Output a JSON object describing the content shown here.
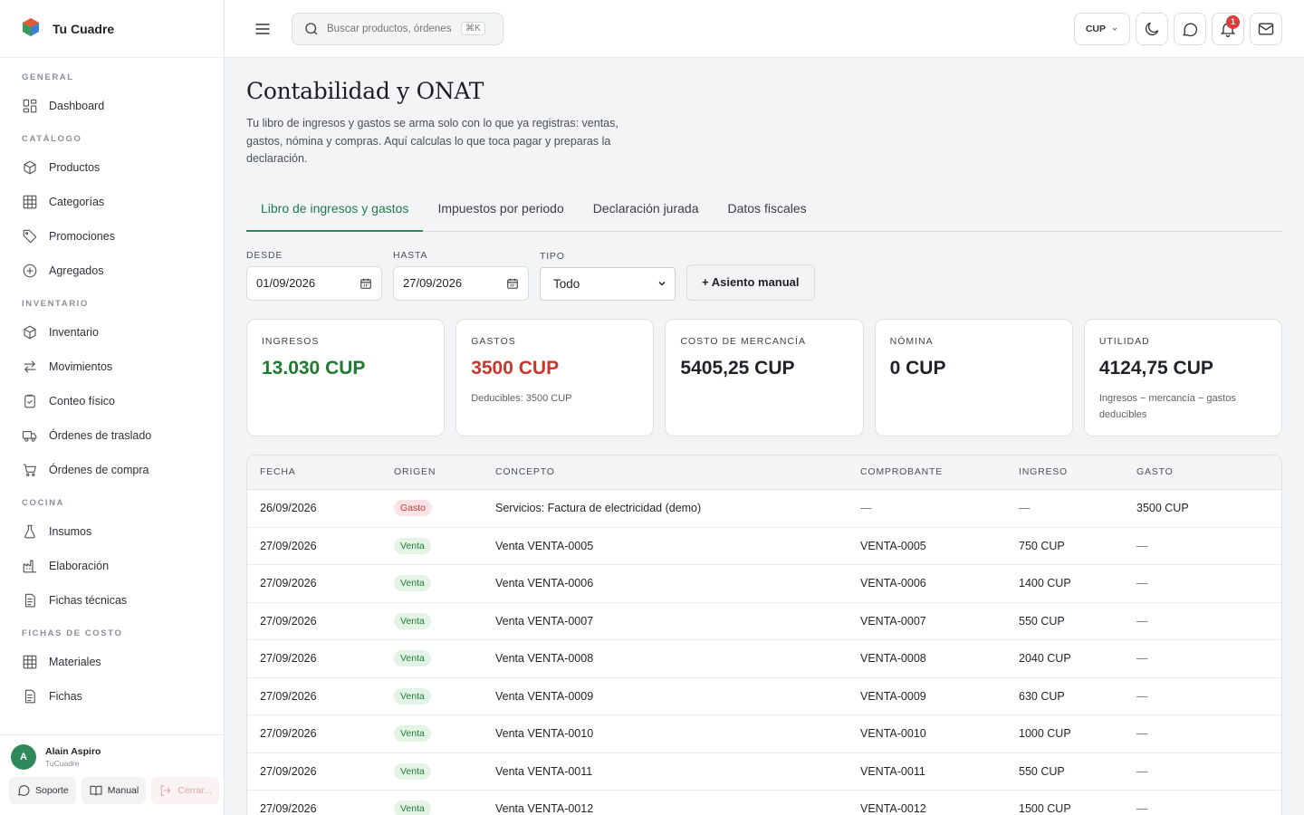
{
  "brand": {
    "name": "Tu Cuadre"
  },
  "sidebar": {
    "sections": [
      {
        "title": "GENERAL",
        "items": [
          {
            "label": "Dashboard",
            "icon": "dashboard-icon"
          }
        ]
      },
      {
        "title": "CATÁLOGO",
        "items": [
          {
            "label": "Productos",
            "icon": "box-icon"
          },
          {
            "label": "Categorías",
            "icon": "grid-icon"
          },
          {
            "label": "Promociones",
            "icon": "tag-icon"
          },
          {
            "label": "Agregados",
            "icon": "plus-circle-icon"
          }
        ]
      },
      {
        "title": "INVENTARIO",
        "items": [
          {
            "label": "Inventario",
            "icon": "box-icon"
          },
          {
            "label": "Movimientos",
            "icon": "arrows-icon"
          },
          {
            "label": "Conteo físico",
            "icon": "clipboard-check-icon"
          },
          {
            "label": "Órdenes de traslado",
            "icon": "truck-icon"
          },
          {
            "label": "Órdenes de compra",
            "icon": "cart-icon"
          }
        ]
      },
      {
        "title": "COCINA",
        "items": [
          {
            "label": "Insumos",
            "icon": "flask-icon"
          },
          {
            "label": "Elaboración",
            "icon": "factory-icon"
          },
          {
            "label": "Fichas técnicas",
            "icon": "document-icon"
          }
        ]
      },
      {
        "title": "FICHAS DE COSTO",
        "items": [
          {
            "label": "Materiales",
            "icon": "grid-icon"
          },
          {
            "label": "Fichas",
            "icon": "document-icon"
          }
        ]
      }
    ],
    "user": {
      "initial": "A",
      "name": "Alain Aspiro",
      "org": "TuCuadre"
    },
    "footer": {
      "support": "Soporte",
      "manual": "Manual",
      "logout": "Cerrar..."
    }
  },
  "topbar": {
    "search_placeholder": "Buscar productos, órdenes",
    "shortcut": "⌘K",
    "currency": "CUP",
    "notifications_count": "1"
  },
  "page": {
    "title": "Contabilidad y ONAT",
    "description": "Tu libro de ingresos y gastos se arma solo con lo que ya registras: ventas, gastos, nómina y compras. Aquí calculas lo que toca pagar y preparas la declaración.",
    "tabs": [
      "Libro de ingresos y gastos",
      "Impuestos por periodo",
      "Declaración jurada",
      "Datos fiscales"
    ],
    "active_tab": 0
  },
  "filters": {
    "from_label": "DESDE",
    "from_value": "01/09/2026",
    "to_label": "HASTA",
    "to_value": "27/09/2026",
    "type_label": "TIPO",
    "type_value": "Todo",
    "manual_button": "+ Asiento manual"
  },
  "summary": [
    {
      "label": "INGRESOS",
      "value": "13.030 CUP",
      "tone": "green",
      "note": ""
    },
    {
      "label": "GASTOS",
      "value": "3500 CUP",
      "tone": "red",
      "note": "Deducibles: 3500 CUP"
    },
    {
      "label": "COSTO DE MERCANCÍA",
      "value": "5405,25 CUP",
      "tone": "",
      "note": ""
    },
    {
      "label": "NÓMINA",
      "value": "0 CUP",
      "tone": "",
      "note": ""
    },
    {
      "label": "UTILIDAD",
      "value": "4124,75 CUP",
      "tone": "",
      "note": "Ingresos − mercancía − gastos deducibles"
    }
  ],
  "table": {
    "headers": [
      "FECHA",
      "ORIGEN",
      "CONCEPTO",
      "COMPROBANTE",
      "INGRESO",
      "GASTO"
    ],
    "rows": [
      {
        "fecha": "26/09/2026",
        "origen": "Gasto",
        "concepto": "Servicios: Factura de electricidad (demo)",
        "comprobante": "—",
        "ingreso": "—",
        "gasto": "3500 CUP"
      },
      {
        "fecha": "27/09/2026",
        "origen": "Venta",
        "concepto": "Venta VENTA-0005",
        "comprobante": "VENTA-0005",
        "ingreso": "750 CUP",
        "gasto": "—"
      },
      {
        "fecha": "27/09/2026",
        "origen": "Venta",
        "concepto": "Venta VENTA-0006",
        "comprobante": "VENTA-0006",
        "ingreso": "1400 CUP",
        "gasto": "—"
      },
      {
        "fecha": "27/09/2026",
        "origen": "Venta",
        "concepto": "Venta VENTA-0007",
        "comprobante": "VENTA-0007",
        "ingreso": "550 CUP",
        "gasto": "—"
      },
      {
        "fecha": "27/09/2026",
        "origen": "Venta",
        "concepto": "Venta VENTA-0008",
        "comprobante": "VENTA-0008",
        "ingreso": "2040 CUP",
        "gasto": "—"
      },
      {
        "fecha": "27/09/2026",
        "origen": "Venta",
        "concepto": "Venta VENTA-0009",
        "comprobante": "VENTA-0009",
        "ingreso": "630 CUP",
        "gasto": "—"
      },
      {
        "fecha": "27/09/2026",
        "origen": "Venta",
        "concepto": "Venta VENTA-0010",
        "comprobante": "VENTA-0010",
        "ingreso": "1000 CUP",
        "gasto": "—"
      },
      {
        "fecha": "27/09/2026",
        "origen": "Venta",
        "concepto": "Venta VENTA-0011",
        "comprobante": "VENTA-0011",
        "ingreso": "550 CUP",
        "gasto": "—"
      },
      {
        "fecha": "27/09/2026",
        "origen": "Venta",
        "concepto": "Venta VENTA-0012",
        "comprobante": "VENTA-0012",
        "ingreso": "1500 CUP",
        "gasto": "—"
      }
    ]
  }
}
